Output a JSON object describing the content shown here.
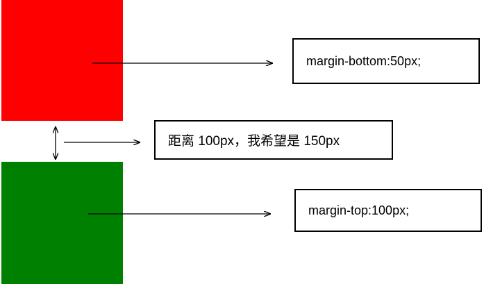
{
  "blocks": {
    "top": {
      "color": "#ff0000"
    },
    "bottom": {
      "color": "#008000"
    }
  },
  "labels": {
    "margin_bottom": "margin-bottom:50px;",
    "distance": "距离 100px，我希望是 150px",
    "margin_top": "margin-top:100px;"
  }
}
